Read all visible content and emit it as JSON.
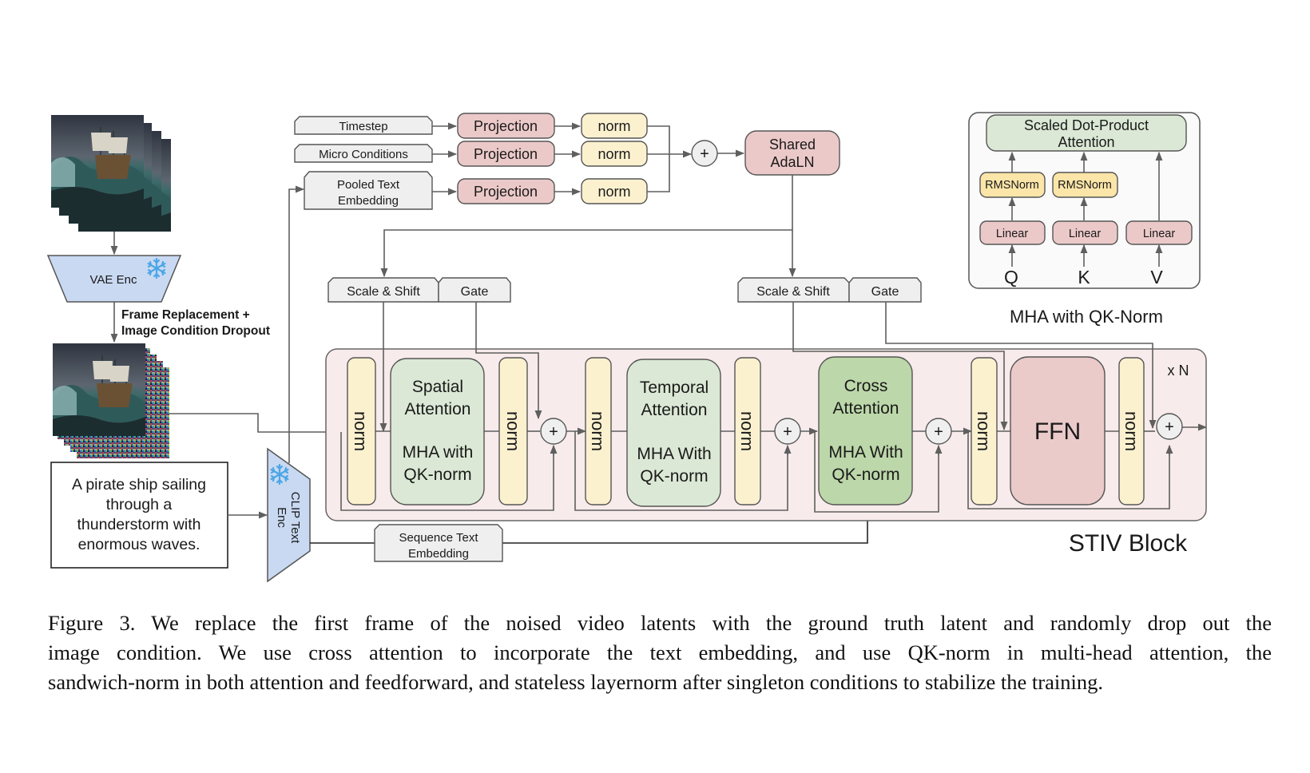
{
  "figure": {
    "inputs": {
      "timestep": "Timestep",
      "micro_conditions": "Micro Conditions",
      "pooled_text_line1": "Pooled Text",
      "pooled_text_line2": "Embedding",
      "projection": "Projection",
      "norm": "norm",
      "plus": "+",
      "shared_adaln_line1": "Shared",
      "shared_adaln_line2": "AdaLN"
    },
    "left": {
      "vae_enc": "VAE Enc",
      "frame_replacement_line1": "Frame Replacement +",
      "frame_replacement_line2": "Image Condition Dropout",
      "prompt_lines": [
        "A pirate ship sailing",
        "through a",
        "thunderstorm with",
        "enormous waves."
      ],
      "clip_line1": "CLIP Text",
      "clip_line2": "Enc",
      "sequence_text_line1": "Sequence Text",
      "sequence_text_line2": "Embedding",
      "frozen_icon": "snowflake-icon"
    },
    "modulation": {
      "scale_shift": "Scale & Shift",
      "gate": "Gate"
    },
    "stiv_block": {
      "title": "STIV Block",
      "repeat": "x N",
      "norm": "norm",
      "spatial_line1": "Spatial",
      "spatial_line2": "Attention",
      "spatial_line3": "MHA with",
      "spatial_line4": "QK-norm",
      "temporal_line1": "Temporal",
      "temporal_line2": "Attention",
      "temporal_line3": "MHA With",
      "temporal_line4": "QK-norm",
      "cross_line1": "Cross",
      "cross_line2": "Attention",
      "cross_line3": "MHA With",
      "cross_line4": "QK-norm",
      "ffn": "FFN",
      "plus": "+"
    },
    "mha_panel": {
      "title": "MHA with QK-Norm",
      "sdpa_line1": "Scaled Dot-Product",
      "sdpa_line2": "Attention",
      "rmsnorm": "RMSNorm",
      "linear": "Linear",
      "q": "Q",
      "k": "K",
      "v": "V"
    },
    "colors": {
      "projection_fill": "#ecc9c9",
      "norm_fill": "#fcf1cf",
      "attention_fill": "#dbe8d5",
      "cross_attention_fill": "#bcd7a9",
      "ffn_fill": "#ebcaca",
      "block_fill": "#f8ebeb",
      "encoder_fill": "#c9d9f2",
      "tag_fill": "#efefef",
      "rmsnorm_fill": "#fbe5a8",
      "snowflake": "#4ba6e6"
    }
  },
  "caption": {
    "lines": [
      "Figure 3.  We replace the first frame of the noised video latents with the ground truth latent and randomly drop out the",
      "image condition. We use cross attention to incorporate the text embedding, and use QK-norm in multi-head attention, the",
      "sandwich-norm in both attention and feedforward, and stateless layernorm after singleton conditions to stabilize the training."
    ]
  }
}
